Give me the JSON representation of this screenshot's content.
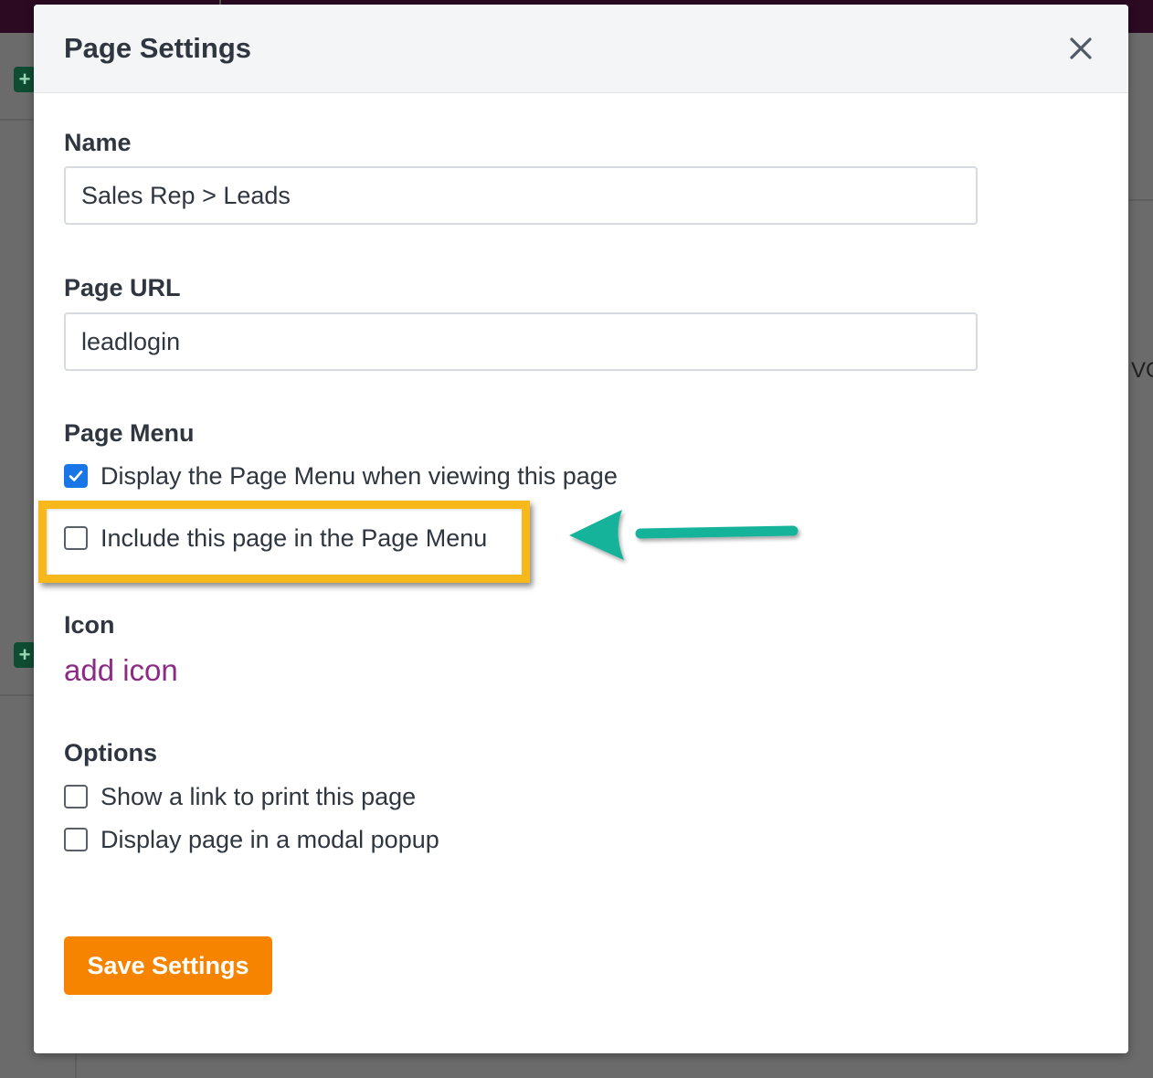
{
  "modal": {
    "title": "Page Settings"
  },
  "name_field": {
    "label": "Name",
    "value": "Sales Rep > Leads"
  },
  "url_field": {
    "label": "Page URL",
    "value": "leadlogin"
  },
  "page_menu": {
    "label": "Page Menu",
    "options": [
      {
        "label": "Display the Page Menu when viewing this page",
        "checked": true
      },
      {
        "label": "Include this page in the Page Menu",
        "checked": false
      }
    ]
  },
  "icon": {
    "label": "Icon",
    "link_text": "add icon"
  },
  "options": {
    "label": "Options",
    "items": [
      {
        "label": "Show a link to print this page",
        "checked": false
      },
      {
        "label": "Display page in a modal popup",
        "checked": false
      }
    ]
  },
  "save_button": {
    "label": "Save Settings"
  },
  "background": {
    "partial_text": "VO"
  },
  "colors": {
    "accent_blue": "#1976e6",
    "link_purple": "#8c2b86",
    "save_orange": "#f78400",
    "highlight_yellow": "#f6b81a",
    "arrow_teal": "#12b39b"
  }
}
